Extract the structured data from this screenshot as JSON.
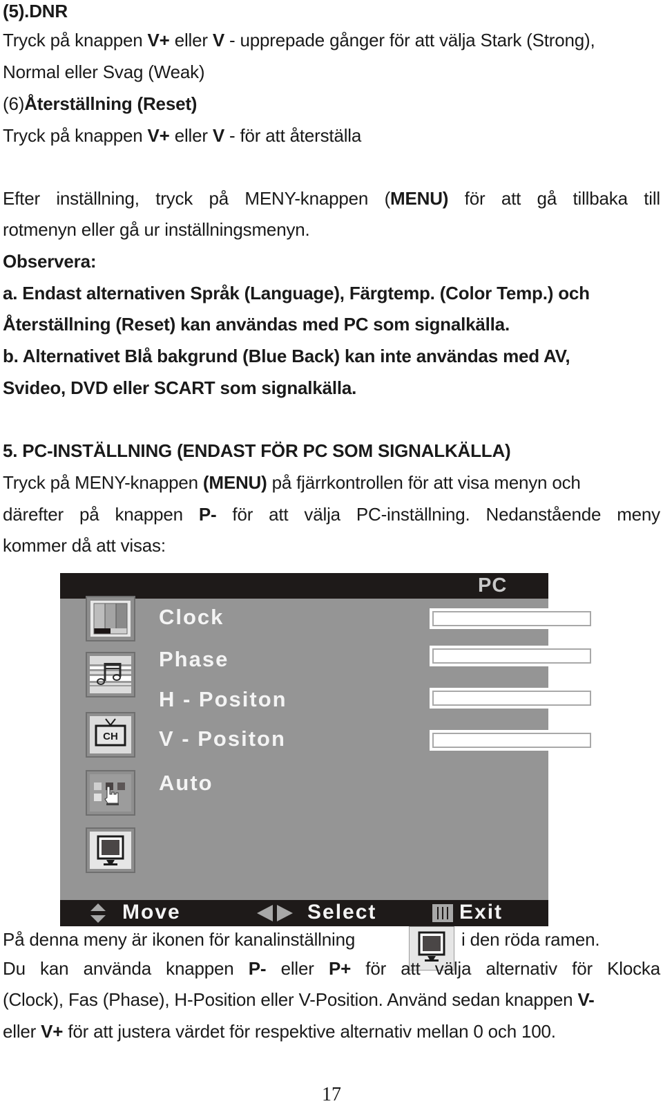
{
  "section_dnr": {
    "heading": "(5).DNR",
    "line1_a": "Tryck på knappen ",
    "line1_b": "V+",
    "line1_c": " eller ",
    "line1_d": "V",
    "line1_e": " - upprepade gånger för att välja Stark (Strong),",
    "line2": "Normal eller Svag (Weak)"
  },
  "section_reset": {
    "prefix": "(6)",
    "heading": "Återställning (Reset)",
    "line1_a": "Tryck på knappen ",
    "line1_b": "V+",
    "line1_c": " eller ",
    "line1_d": "V",
    "line1_e": " - för att återställa"
  },
  "after_settings": {
    "line1_a": "Efter inställning, tryck på MENY-knappen (",
    "line1_b": "MENU)",
    "line1_c": " för att gå tillbaka till",
    "line2": "rotmenyn eller gå ur inställningsmenyn."
  },
  "note": {
    "heading": "Observera:",
    "a_line1": "a. Endast alternativen Språk (Language), Färgtemp. (Color Temp.) och",
    "a_line2": "Återställning (Reset) kan användas med PC som signalkälla.",
    "b_line1": "b. Alternativet Blå bakgrund (Blue Back) kan inte användas med AV,",
    "b_line2": "Svideo, DVD eller SCART som signalkälla."
  },
  "section_pc": {
    "heading": "5.  PC-INSTÄLLNING (ENDAST FÖR PC SOM SIGNALKÄLLA)",
    "line1_a": "Tryck på MENY-knappen ",
    "line1_b": "(MENU)",
    "line1_c": " på fjärrkontrollen för att visa menyn och",
    "line2_a": "därefter på knappen ",
    "line2_b": "P-",
    "line2_c": " för att välja PC-inställning. Nedanstående meny",
    "line3": "kommer då att visas:"
  },
  "osd_menu": {
    "title": "PC",
    "items": [
      {
        "label": "Clock",
        "icon": "picture-icon",
        "has_bar": true
      },
      {
        "label": "Phase",
        "icon": "sound-icon",
        "has_bar": true
      },
      {
        "label": "H - Positon",
        "icon": "channel-icon",
        "has_bar": true
      },
      {
        "label": "V - Positon",
        "icon": "function-icon",
        "has_bar": true
      },
      {
        "label": "Auto",
        "icon": "",
        "has_bar": false
      }
    ],
    "bottom_icon": "pc-monitor-icon",
    "hints": {
      "move": "Move",
      "select": "Select",
      "exit": "Exit"
    }
  },
  "after_menu": {
    "line1_a": "På denna meny är ikonen för kanalinställning",
    "line1_b": "i den röda ramen.",
    "line2_a": "Du kan använda knappen ",
    "line2_b": "P-",
    "line2_c": " eller ",
    "line2_d": "P+",
    "line2_e": " för att välja alternativ för Klocka",
    "line3_a": "(Clock), Fas (Phase), H-Position eller V-Position. Använd sedan knappen ",
    "line3_b": "V-",
    "line4_a": "eller ",
    "line4_b": "V+",
    "line4_c": " för att justera värdet för respektive alternativ mellan 0 och 100."
  },
  "page_number": "17"
}
